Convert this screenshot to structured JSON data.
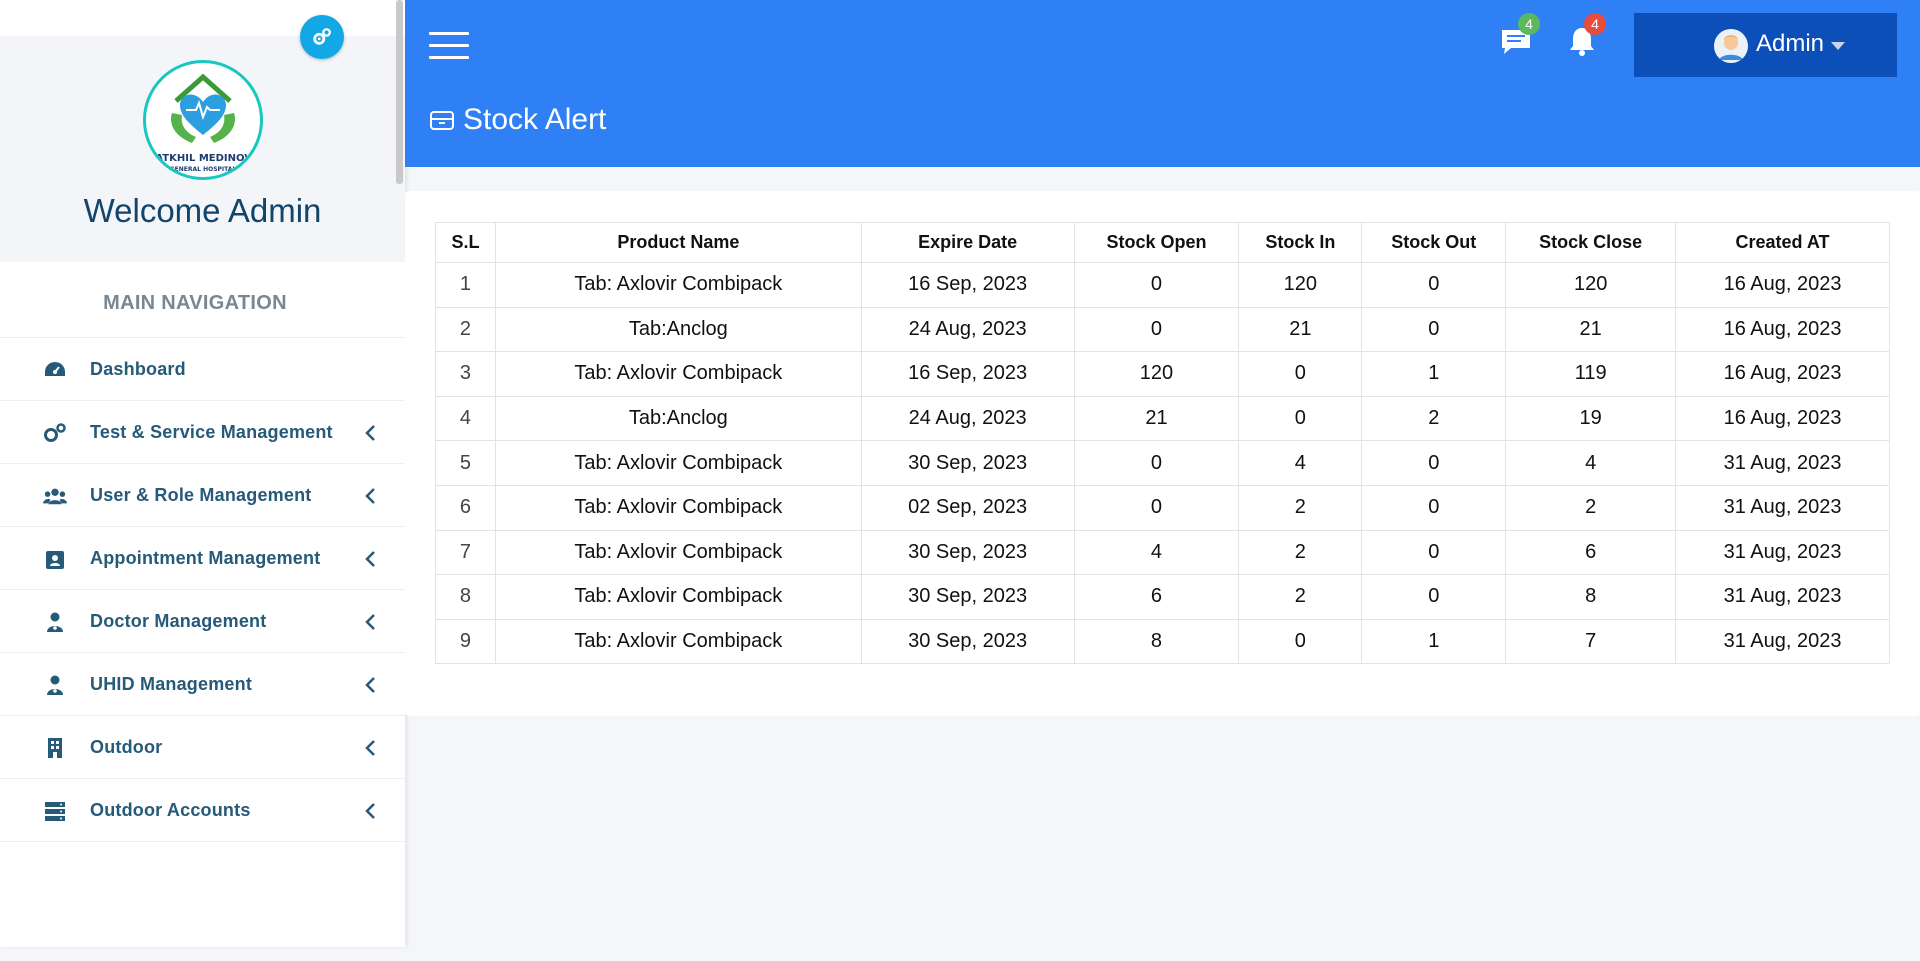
{
  "sidebar": {
    "logo": {
      "top_text": "HATKHIL MEDINOVA",
      "bottom_text": "GENERAL HOSPITAL"
    },
    "welcome": "Welcome Admin",
    "nav_header": "MAIN NAVIGATION",
    "items": [
      {
        "label": "Dashboard",
        "icon": "dashboard-icon",
        "has_submenu": false
      },
      {
        "label": "Test & Service Management",
        "icon": "gears-icon",
        "has_submenu": true
      },
      {
        "label": "User & Role Management",
        "icon": "users-icon",
        "has_submenu": true
      },
      {
        "label": "Appointment Management",
        "icon": "appointment-icon",
        "has_submenu": true
      },
      {
        "label": "Doctor Management",
        "icon": "doctor-icon",
        "has_submenu": true
      },
      {
        "label": "UHID Management",
        "icon": "doctor-icon",
        "has_submenu": true
      },
      {
        "label": "Outdoor",
        "icon": "building-icon",
        "has_submenu": true
      },
      {
        "label": "Outdoor Accounts",
        "icon": "server-icon",
        "has_submenu": true
      }
    ]
  },
  "header": {
    "messages_badge": "4",
    "notifications_badge": "4",
    "user_name": "Admin",
    "page_title": "Stock Alert",
    "colors": {
      "header_bg": "#2f7ff5",
      "user_box_bg": "#0d4fb8",
      "badge_green": "#5cb85c",
      "badge_red": "#e74c3c"
    }
  },
  "table": {
    "columns": [
      "S.L",
      "Product Name",
      "Expire Date",
      "Stock Open",
      "Stock In",
      "Stock Out",
      "Stock Close",
      "Created AT"
    ],
    "rows": [
      [
        "1",
        "Tab: Axlovir Combipack",
        "16 Sep, 2023",
        "0",
        "120",
        "0",
        "120",
        "16 Aug, 2023"
      ],
      [
        "2",
        "Tab:Anclog",
        "24 Aug, 2023",
        "0",
        "21",
        "0",
        "21",
        "16 Aug, 2023"
      ],
      [
        "3",
        "Tab: Axlovir Combipack",
        "16 Sep, 2023",
        "120",
        "0",
        "1",
        "119",
        "16 Aug, 2023"
      ],
      [
        "4",
        "Tab:Anclog",
        "24 Aug, 2023",
        "21",
        "0",
        "2",
        "19",
        "16 Aug, 2023"
      ],
      [
        "5",
        "Tab: Axlovir Combipack",
        "30 Sep, 2023",
        "0",
        "4",
        "0",
        "4",
        "31 Aug, 2023"
      ],
      [
        "6",
        "Tab: Axlovir Combipack",
        "02 Sep, 2023",
        "0",
        "2",
        "0",
        "2",
        "31 Aug, 2023"
      ],
      [
        "7",
        "Tab: Axlovir Combipack",
        "30 Sep, 2023",
        "4",
        "2",
        "0",
        "6",
        "31 Aug, 2023"
      ],
      [
        "8",
        "Tab: Axlovir Combipack",
        "30 Sep, 2023",
        "6",
        "2",
        "0",
        "8",
        "31 Aug, 2023"
      ],
      [
        "9",
        "Tab: Axlovir Combipack",
        "30 Sep, 2023",
        "8",
        "0",
        "1",
        "7",
        "31 Aug, 2023"
      ]
    ]
  }
}
